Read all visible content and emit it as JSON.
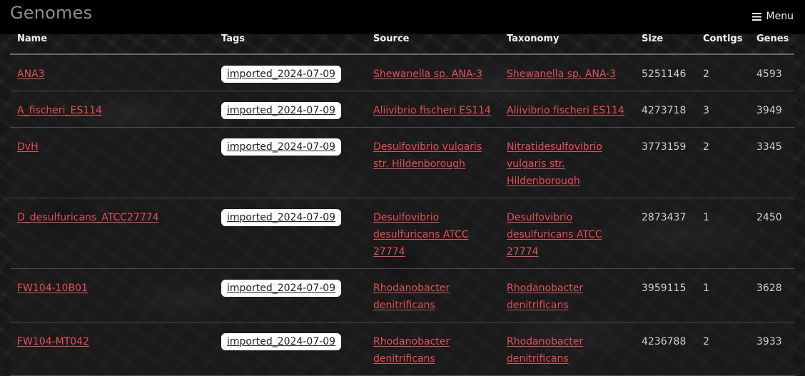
{
  "header": {
    "title": "Genomes",
    "menu_label": "Menu"
  },
  "table": {
    "columns": [
      "Name",
      "Tags",
      "Source",
      "Taxonomy",
      "Size",
      "Contigs",
      "Genes"
    ],
    "rows": [
      {
        "name": "ANA3",
        "tag": "imported_2024-07-09",
        "source": "Shewanella sp. ANA-3",
        "taxonomy": "Shewanella sp. ANA-3",
        "size": "5251146",
        "contigs": "2",
        "genes": "4593"
      },
      {
        "name": "A_fischeri_ES114",
        "tag": "imported_2024-07-09",
        "source": "Aliivibrio fischeri ES114",
        "taxonomy": "Aliivibrio fischeri ES114",
        "size": "4273718",
        "contigs": "3",
        "genes": "3949"
      },
      {
        "name": "DvH",
        "tag": "imported_2024-07-09",
        "source": "Desulfovibrio vulgaris str. Hildenborough",
        "taxonomy": "Nitratidesulfovibrio vulgaris str. Hildenborough",
        "size": "3773159",
        "contigs": "2",
        "genes": "3345"
      },
      {
        "name": "D_desulfuricans_ATCC27774",
        "tag": "imported_2024-07-09",
        "source": "Desulfovibrio desulfuricans ATCC 27774",
        "taxonomy": "Desulfovibrio desulfuricans ATCC 27774",
        "size": "2873437",
        "contigs": "1",
        "genes": "2450"
      },
      {
        "name": "FW104-10B01",
        "tag": "imported_2024-07-09",
        "source": "Rhodanobacter denitrificans",
        "taxonomy": "Rhodanobacter denitrificans",
        "size": "3959115",
        "contigs": "1",
        "genes": "3628"
      },
      {
        "name": "FW104-MT042",
        "tag": "imported_2024-07-09",
        "source": "Rhodanobacter denitrificans",
        "taxonomy": "Rhodanobacter denitrificans",
        "size": "4236788",
        "contigs": "2",
        "genes": "3933"
      }
    ]
  },
  "colors": {
    "header_bg": "#000000",
    "title": "#8d8d8d",
    "link": "#e2505a",
    "tag_bg": "#ffffff",
    "text": "#cfcfcf"
  },
  "icons": {
    "menu": "hamburger-icon"
  }
}
